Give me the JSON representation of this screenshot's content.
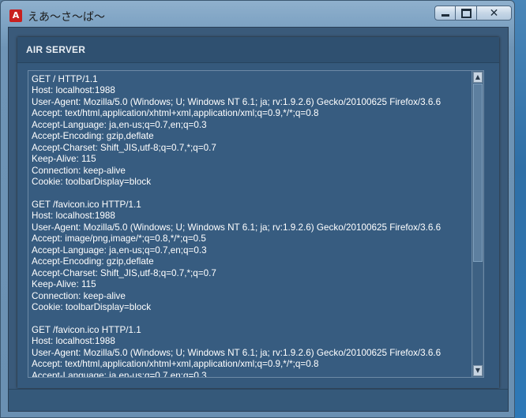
{
  "window": {
    "title": "えあ～さ～ば～",
    "app_icon_glyph": "A",
    "controls": {
      "minimize": "minimize-icon",
      "maximize": "maximize-icon",
      "close": "close-icon"
    }
  },
  "panel": {
    "title": "AIR SERVER",
    "log_lines": [
      "GET / HTTP/1.1",
      "Host: localhost:1988",
      "User-Agent: Mozilla/5.0 (Windows; U; Windows NT 6.1; ja; rv:1.9.2.6) Gecko/20100625 Firefox/3.6.6",
      "Accept: text/html,application/xhtml+xml,application/xml;q=0.9,*/*;q=0.8",
      "Accept-Language: ja,en-us;q=0.7,en;q=0.3",
      "Accept-Encoding: gzip,deflate",
      "Accept-Charset: Shift_JIS,utf-8;q=0.7,*;q=0.7",
      "Keep-Alive: 115",
      "Connection: keep-alive",
      "Cookie: toolbarDisplay=block",
      "",
      "GET /favicon.ico HTTP/1.1",
      "Host: localhost:1988",
      "User-Agent: Mozilla/5.0 (Windows; U; Windows NT 6.1; ja; rv:1.9.2.6) Gecko/20100625 Firefox/3.6.6",
      "Accept: image/png,image/*;q=0.8,*/*;q=0.5",
      "Accept-Language: ja,en-us;q=0.7,en;q=0.3",
      "Accept-Encoding: gzip,deflate",
      "Accept-Charset: Shift_JIS,utf-8;q=0.7,*;q=0.7",
      "Keep-Alive: 115",
      "Connection: keep-alive",
      "Cookie: toolbarDisplay=block",
      "",
      "GET /favicon.ico HTTP/1.1",
      "Host: localhost:1988",
      "User-Agent: Mozilla/5.0 (Windows; U; Windows NT 6.1; ja; rv:1.9.2.6) Gecko/20100625 Firefox/3.6.6",
      "Accept: text/html,application/xhtml+xml,application/xml;q=0.9,*/*;q=0.8",
      "Accept-Language: ja,en-us;q=0.7,en;q=0.3"
    ]
  },
  "scrollbar": {
    "up_glyph": "▲",
    "down_glyph": "▼"
  },
  "colors": {
    "panel": "#35597c",
    "text": "#ffffff",
    "accent": "#c8201f"
  }
}
